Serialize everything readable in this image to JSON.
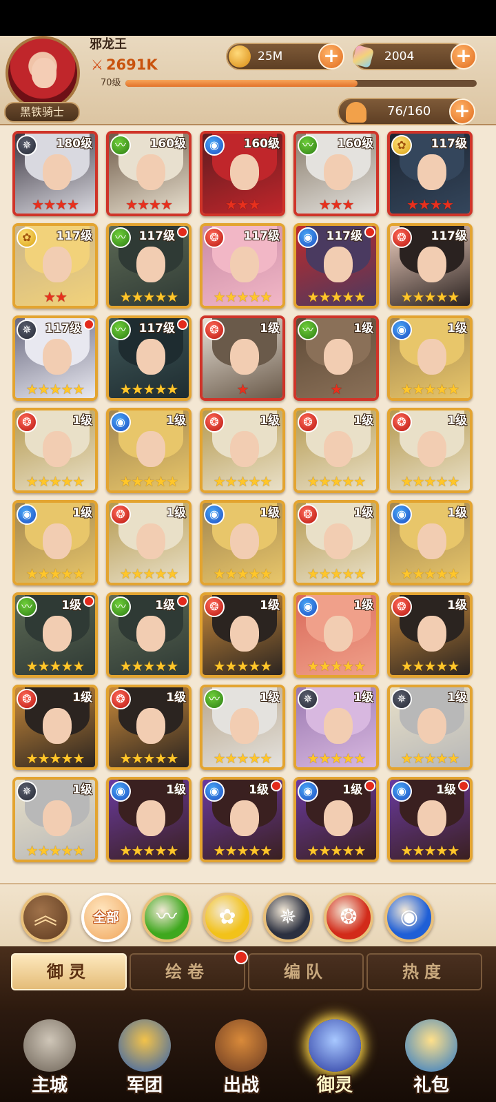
{
  "header": {
    "player_name": "邪龙王",
    "power": "2691K",
    "level": "70级",
    "xp_progress": 0.66,
    "title_badge": "黑铁骑士",
    "gold": "25M",
    "gems": "2004",
    "population": "76/160",
    "plus_symbol": "+"
  },
  "filters": {
    "up_symbol": "︽",
    "all_label": "全部",
    "elements": [
      {
        "name": "wood",
        "symbol": "〰",
        "color": "#3ea81e"
      },
      {
        "name": "gold",
        "symbol": "✿",
        "color": "#f2c21a"
      },
      {
        "name": "dark",
        "symbol": "✵",
        "color": "#2b3040"
      },
      {
        "name": "fire",
        "symbol": "❂",
        "color": "#d22b1a"
      },
      {
        "name": "water",
        "symbol": "◉",
        "color": "#1f5fd6"
      }
    ]
  },
  "tabs": [
    {
      "label": "御灵",
      "active": true
    },
    {
      "label": "绘卷",
      "active": false,
      "dot": true
    },
    {
      "label": "编队",
      "active": false
    },
    {
      "label": "热度",
      "active": false
    }
  ],
  "nav": [
    {
      "label": "主城",
      "active": false
    },
    {
      "label": "军团",
      "active": false
    },
    {
      "label": "出战",
      "active": false
    },
    {
      "label": "御灵",
      "active": true
    },
    {
      "label": "礼包",
      "active": false
    }
  ],
  "heroes": [
    {
      "level": "180级",
      "element": "dark",
      "stars": 4,
      "star_color": "red",
      "frame": "red",
      "dot": false
    },
    {
      "level": "160级",
      "element": "wood",
      "stars": 4,
      "star_color": "red",
      "frame": "red",
      "dot": false
    },
    {
      "level": "160级",
      "element": "water",
      "stars": 3,
      "star_color": "red",
      "frame": "red",
      "dot": false
    },
    {
      "level": "160级",
      "element": "wood",
      "stars": 3,
      "star_color": "red",
      "frame": "red",
      "dot": false
    },
    {
      "level": "117级",
      "element": "gold",
      "stars": 4,
      "star_color": "red",
      "frame": "red",
      "dot": false
    },
    {
      "level": "117级",
      "element": "gold",
      "stars": 2,
      "star_color": "red",
      "frame": "gold",
      "dot": false
    },
    {
      "level": "117级",
      "element": "wood",
      "stars": 5,
      "star_color": "gold",
      "frame": "gold",
      "dot": true
    },
    {
      "level": "117级",
      "element": "fire",
      "stars": 5,
      "star_color": "gold",
      "frame": "gold",
      "dot": false
    },
    {
      "level": "117级",
      "element": "water",
      "stars": 5,
      "star_color": "gold",
      "frame": "gold",
      "dot": true
    },
    {
      "level": "117级",
      "element": "fire",
      "stars": 5,
      "star_color": "gold",
      "frame": "gold",
      "dot": false
    },
    {
      "level": "117级",
      "element": "dark",
      "stars": 5,
      "star_color": "gold",
      "frame": "gold",
      "dot": true
    },
    {
      "level": "117级",
      "element": "wood",
      "stars": 5,
      "star_color": "gold",
      "frame": "gold",
      "dot": true
    },
    {
      "level": "1级",
      "element": "fire",
      "stars": 1,
      "star_color": "red",
      "frame": "red",
      "dot": false
    },
    {
      "level": "1级",
      "element": "wood",
      "stars": 1,
      "star_color": "red",
      "frame": "red",
      "dot": false
    },
    {
      "level": "1级",
      "element": "water",
      "stars": 5,
      "star_color": "gold",
      "frame": "gold",
      "dot": false
    },
    {
      "level": "1级",
      "element": "fire",
      "stars": 5,
      "star_color": "gold",
      "frame": "gold",
      "dot": false
    },
    {
      "level": "1级",
      "element": "water",
      "stars": 5,
      "star_color": "gold",
      "frame": "gold",
      "dot": false
    },
    {
      "level": "1级",
      "element": "fire",
      "stars": 5,
      "star_color": "gold",
      "frame": "gold",
      "dot": false
    },
    {
      "level": "1级",
      "element": "fire",
      "stars": 5,
      "star_color": "gold",
      "frame": "gold",
      "dot": false
    },
    {
      "level": "1级",
      "element": "fire",
      "stars": 5,
      "star_color": "gold",
      "frame": "gold",
      "dot": false
    },
    {
      "level": "1级",
      "element": "water",
      "stars": 5,
      "star_color": "gold",
      "frame": "gold",
      "dot": false
    },
    {
      "level": "1级",
      "element": "fire",
      "stars": 5,
      "star_color": "gold",
      "frame": "gold",
      "dot": false
    },
    {
      "level": "1级",
      "element": "water",
      "stars": 5,
      "star_color": "gold",
      "frame": "gold",
      "dot": false
    },
    {
      "level": "1级",
      "element": "fire",
      "stars": 5,
      "star_color": "gold",
      "frame": "gold",
      "dot": false
    },
    {
      "level": "1级",
      "element": "water",
      "stars": 5,
      "star_color": "gold",
      "frame": "gold",
      "dot": false
    },
    {
      "level": "1级",
      "element": "wood",
      "stars": 5,
      "star_color": "gold",
      "frame": "gold",
      "dot": true
    },
    {
      "level": "1级",
      "element": "wood",
      "stars": 5,
      "star_color": "gold",
      "frame": "gold",
      "dot": true
    },
    {
      "level": "1级",
      "element": "fire",
      "stars": 5,
      "star_color": "gold",
      "frame": "gold",
      "dot": false
    },
    {
      "level": "1级",
      "element": "water",
      "stars": 5,
      "star_color": "gold",
      "frame": "gold",
      "dot": false
    },
    {
      "level": "1级",
      "element": "fire",
      "stars": 5,
      "star_color": "gold",
      "frame": "gold",
      "dot": false
    },
    {
      "level": "1级",
      "element": "fire",
      "stars": 5,
      "star_color": "gold",
      "frame": "gold",
      "dot": false
    },
    {
      "level": "1级",
      "element": "fire",
      "stars": 5,
      "star_color": "gold",
      "frame": "gold",
      "dot": false
    },
    {
      "level": "1级",
      "element": "wood",
      "stars": 5,
      "star_color": "gold",
      "frame": "gold",
      "dot": false
    },
    {
      "level": "1级",
      "element": "dark",
      "stars": 5,
      "star_color": "gold",
      "frame": "gold",
      "dot": false
    },
    {
      "level": "1级",
      "element": "dark",
      "stars": 5,
      "star_color": "gold",
      "frame": "gold",
      "dot": false
    },
    {
      "level": "1级",
      "element": "dark",
      "stars": 5,
      "star_color": "gold",
      "frame": "gold",
      "dot": false
    },
    {
      "level": "1级",
      "element": "water",
      "stars": 5,
      "star_color": "gold",
      "frame": "gold",
      "dot": false
    },
    {
      "level": "1级",
      "element": "water",
      "stars": 5,
      "star_color": "gold",
      "frame": "gold",
      "dot": true
    },
    {
      "level": "1级",
      "element": "water",
      "stars": 5,
      "star_color": "gold",
      "frame": "gold",
      "dot": true
    },
    {
      "level": "1级",
      "element": "water",
      "stars": 5,
      "star_color": "gold",
      "frame": "gold",
      "dot": true
    }
  ],
  "element_symbols": {
    "wood": "〰",
    "gold": "✿",
    "dark": "✵",
    "fire": "❂",
    "water": "◉"
  },
  "portrait_palettes": [
    [
      "#d9d9e0",
      "#3b3540"
    ],
    [
      "#e8e0cf",
      "#6e5a48"
    ],
    [
      "#c0262b",
      "#5d1b1f"
    ],
    [
      "#e4e2de",
      "#8a7d6c"
    ],
    [
      "#34465c",
      "#1c2430"
    ],
    [
      "#f2d27a",
      "#c9b48a"
    ],
    [
      "#2f3a35",
      "#5d6a55"
    ],
    [
      "#f2b7c6",
      "#c98ba6"
    ],
    [
      "#4a3a60",
      "#c02a2a"
    ],
    [
      "#2a2220",
      "#f0d0c0"
    ],
    [
      "#e8e8f0",
      "#6a6a80"
    ],
    [
      "#1e2c30",
      "#41595a"
    ],
    [
      "#6a5a4a",
      "#e7e0d6"
    ],
    [
      "#8a7058",
      "#5e4a36"
    ],
    [
      "#e8c66a",
      "#a28650"
    ],
    [
      "#e9e0c8",
      "#b59a50"
    ],
    [
      "#e8c66a",
      "#a28650"
    ],
    [
      "#e9e0c8",
      "#b59a50"
    ],
    [
      "#e9e0c8",
      "#b59a50"
    ],
    [
      "#e9e0c8",
      "#b59a50"
    ],
    [
      "#e8c66a",
      "#a28650"
    ],
    [
      "#e9e0c8",
      "#b59a50"
    ],
    [
      "#e8c66a",
      "#a28650"
    ],
    [
      "#e9e0c8",
      "#b59a50"
    ],
    [
      "#e8c66a",
      "#a28650"
    ],
    [
      "#2f3a35",
      "#5d6a55"
    ],
    [
      "#2f3a35",
      "#5d6a55"
    ],
    [
      "#2b2420",
      "#c98a3a"
    ],
    [
      "#f0a08a",
      "#d96a5a"
    ],
    [
      "#2b2420",
      "#c98a3a"
    ],
    [
      "#2b2420",
      "#c98a3a"
    ],
    [
      "#2b2420",
      "#c98a3a"
    ],
    [
      "#e4e2de",
      "#b8a68c"
    ],
    [
      "#d8b8e0",
      "#9a78b0"
    ],
    [
      "#b8b8b8",
      "#e8e0c8"
    ],
    [
      "#b8b8b8",
      "#e8e0c8"
    ],
    [
      "#3a2020",
      "#6a3aa0"
    ],
    [
      "#3a2020",
      "#6a3aa0"
    ],
    [
      "#3a2020",
      "#6a3aa0"
    ],
    [
      "#3a2020",
      "#6a3aa0"
    ]
  ]
}
